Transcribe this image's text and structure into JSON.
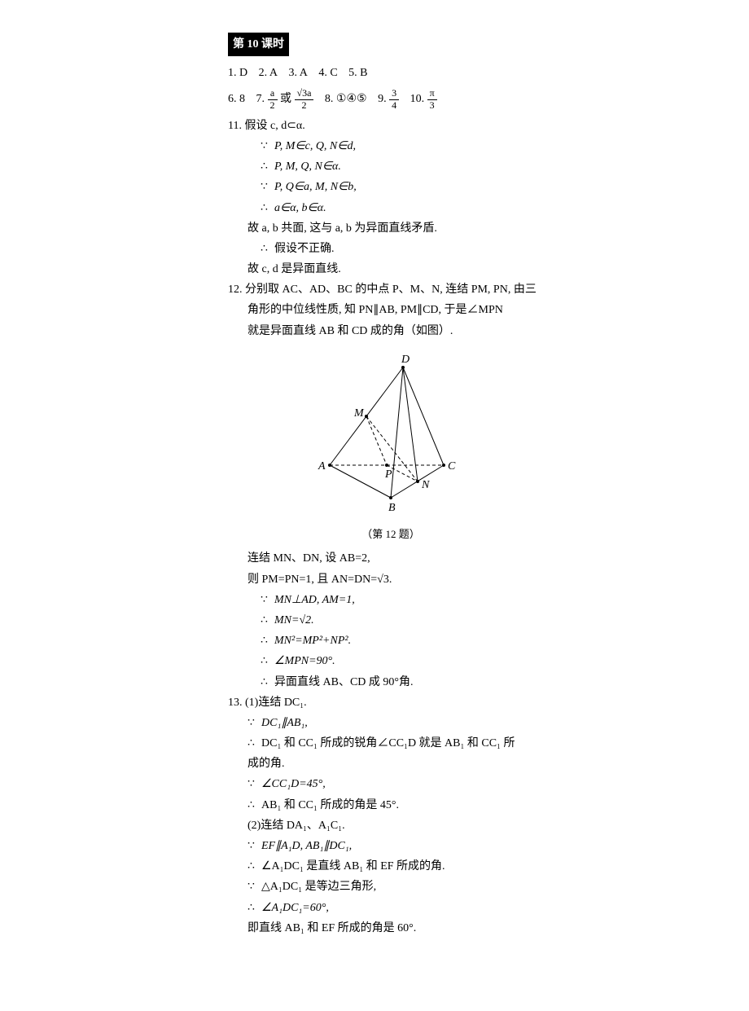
{
  "header": "第 10 课时",
  "row1": {
    "a1": "1. D",
    "a2": "2. A",
    "a3": "3. A",
    "a4": "4. C",
    "a5": "5. B"
  },
  "row2": {
    "a6": "6. 8",
    "a7_pre": "7. ",
    "a7_f1num": "a",
    "a7_f1den": "2",
    "a7_or": "或",
    "a7_f2num": "√3a",
    "a7_f2den": "2",
    "a8": "8. ①④⑤",
    "a9_pre": "9. ",
    "a9_num": "3",
    "a9_den": "4",
    "a10_pre": "10. ",
    "a10_num": "π",
    "a10_den": "3"
  },
  "q11": {
    "head": "11. 假设 c, d⊂α.",
    "l1a": "∵",
    "l1b": "P, M∈c, Q, N∈d,",
    "l2a": "∴",
    "l2b": "P, M, Q, N∈α.",
    "l3a": "∵",
    "l3b": "P, Q∈a, M, N∈b,",
    "l4a": "∴",
    "l4b": "a∈α, b∈α.",
    "l5": "故 a, b 共面, 这与 a, b 为异面直线矛盾.",
    "l6a": "∴",
    "l6b": "假设不正确.",
    "l7": "故 c, d 是异面直线."
  },
  "q12": {
    "l1": "12. 分别取 AC、AD、BC 的中点 P、M、N, 连结 PM, PN, 由三",
    "l2": "角形的中位线性质, 知 PN∥AB, PM∥CD, 于是∠MPN",
    "l3": "就是异面直线 AB 和 CD 成的角（如图）.",
    "caption": "（第 12 题）",
    "l4": "连结 MN、DN, 设 AB=2,",
    "l5": "则 PM=PN=1, 且 AN=DN=√3.",
    "l6a": "∵",
    "l6b": "MN⊥AD, AM=1,",
    "l7a": "∴",
    "l7b": "MN=√2.",
    "l8a": "∴",
    "l8b": "MN²=MP²+NP².",
    "l9a": "∴",
    "l9b": "∠MPN=90°.",
    "l10a": "∴",
    "l10b": "异面直线 AB、CD 成 90°角."
  },
  "q13": {
    "l1": "13. (1)连结 DC₁.",
    "l2a": "∵",
    "l2b": "DC₁∥AB₁,",
    "l3a": "∴",
    "l3b": "DC₁ 和 CC₁ 所成的锐角∠CC₁D 就是 AB₁ 和 CC₁ 所",
    "l3c": "成的角.",
    "l4a": "∵",
    "l4b": "∠CC₁D=45°,",
    "l5a": "∴",
    "l5b": "AB₁ 和 CC₁ 所成的角是 45°.",
    "l6": "(2)连结 DA₁、A₁C₁.",
    "l7a": "∵",
    "l7b": "EF∥A₁D, AB₁∥DC₁,",
    "l8a": "∴",
    "l8b": "∠A₁DC₁ 是直线 AB₁ 和 EF 所成的角.",
    "l9a": "∵",
    "l9b": "△A₁DC₁ 是等边三角形,",
    "l10a": "∴",
    "l10b": "∠A₁DC₁=60°,",
    "l11": "即直线 AB₁ 和 EF 所成的角是 60°."
  },
  "diagram": {
    "labels": [
      "D",
      "M",
      "A",
      "P",
      "N",
      "B",
      "C"
    ]
  }
}
